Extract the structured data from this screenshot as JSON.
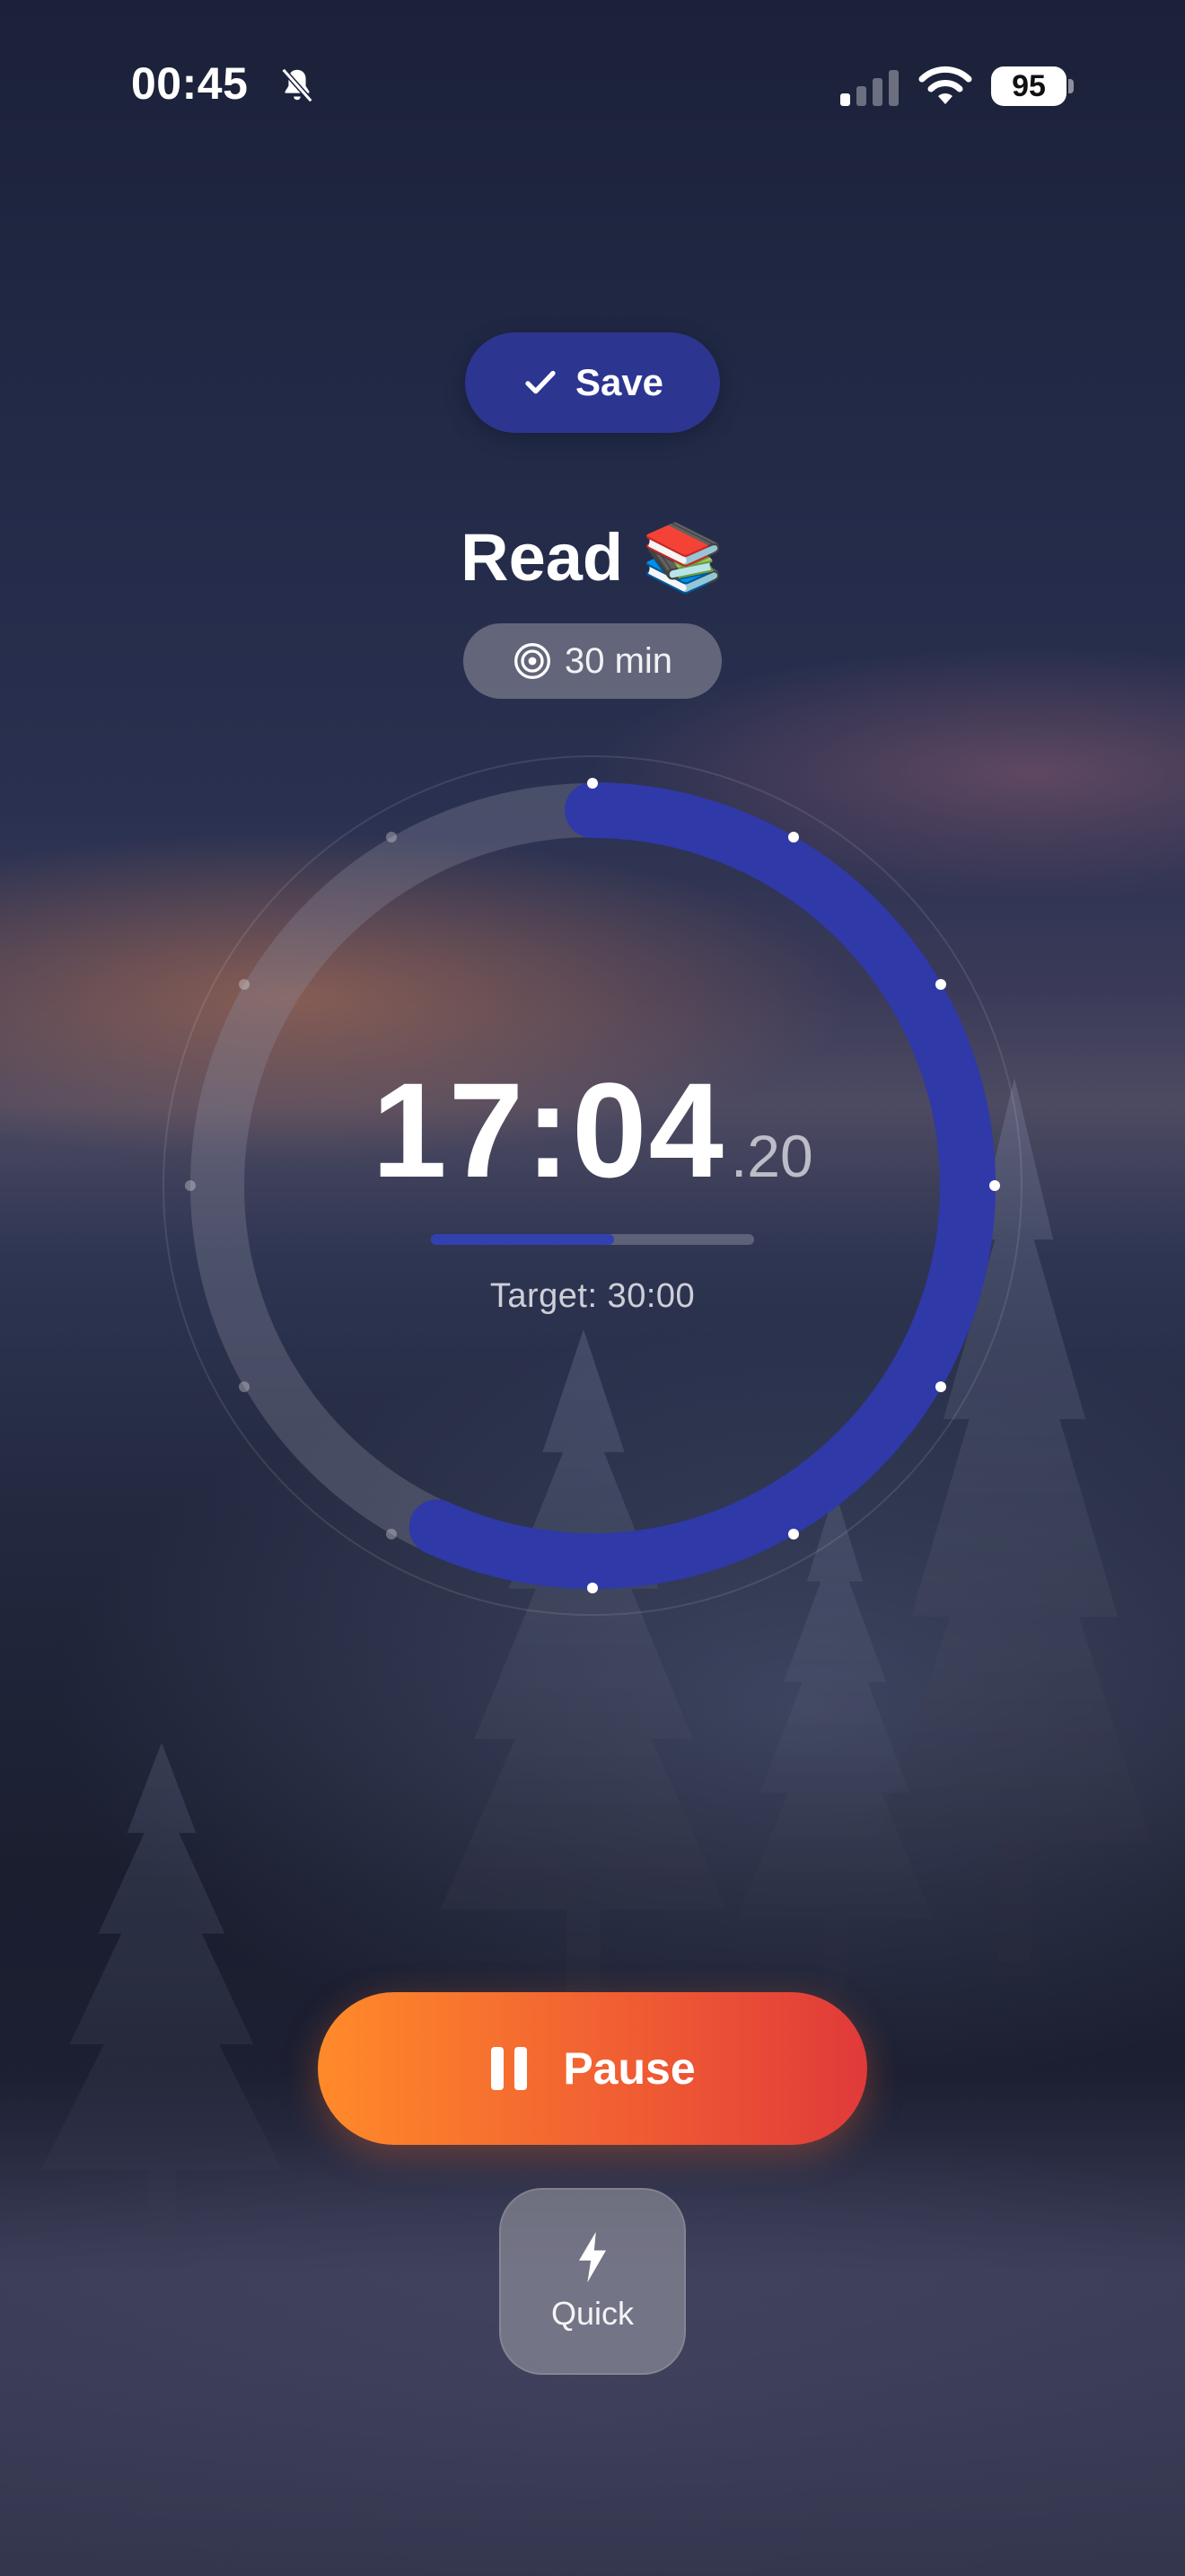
{
  "status_bar": {
    "time": "00:45",
    "battery": "95",
    "icons": [
      "bell-slash-icon",
      "cellular-signal-icon",
      "wifi-icon",
      "battery-icon"
    ]
  },
  "save": {
    "label": "Save",
    "icon": "checkmark-icon"
  },
  "task": {
    "title": "Read 📚"
  },
  "goal": {
    "label": "30 min",
    "icon": "target-icon"
  },
  "timer": {
    "elapsed": "17:04",
    "fraction": ".20",
    "target_text": "Target: 30:00",
    "progress_fraction": 0.568
  },
  "actions": {
    "pause_label": "Pause",
    "pause_icon": "pause-icon",
    "quick_label": "Quick",
    "quick_icon": "lightning-bolt-icon"
  },
  "colors": {
    "accent": "#2c3590",
    "ring": "#2f39a8",
    "pause_start": "#ff8a2a",
    "pause_end": "#e03a3a"
  }
}
